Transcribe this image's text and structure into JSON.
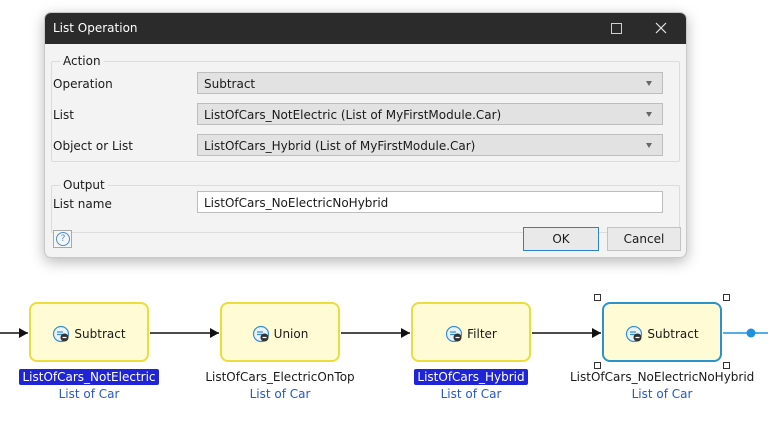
{
  "dialog": {
    "title": "List Operation",
    "action_group": {
      "legend": "Action",
      "operation_label": "Operation",
      "operation_value": "Subtract",
      "list_label": "List",
      "list_value": "ListOfCars_NotElectric (List of MyFirstModule.Car)",
      "object_label": "Object or List",
      "object_value": "ListOfCars_Hybrid (List of MyFirstModule.Car)"
    },
    "output_group": {
      "legend": "Output",
      "list_name_label": "List name",
      "list_name_value": "ListOfCars_NoElectricNoHybrid"
    },
    "help_icon_glyph": "?",
    "ok_label": "OK",
    "cancel_label": "Cancel"
  },
  "flow": {
    "activities": [
      {
        "name": "Subtract",
        "var": "ListOfCars_NotElectric",
        "type": "List of Car",
        "highlighted": true,
        "selected": false
      },
      {
        "name": "Union",
        "var": "ListOfCars_ElectricOnTop",
        "type": "List of Car",
        "highlighted": false,
        "selected": false
      },
      {
        "name": "Filter",
        "var": "ListOfCars_Hybrid",
        "type": "List of Car",
        "highlighted": true,
        "selected": false
      },
      {
        "name": "Subtract",
        "var": "ListOfCars_NoElectricNoHybrid",
        "type": "List of Car",
        "highlighted": false,
        "selected": true
      }
    ]
  },
  "colors": {
    "titlebar": "#2b2b2b",
    "activity_fill": "#fffbd4",
    "activity_border": "#eadd3c",
    "selected_border": "#2a93c9",
    "highlight": "#1f24d8",
    "type_text": "#2456d6",
    "flow_line": "#111111",
    "end_dot": "#1e90e0"
  },
  "icons": {
    "maximize": "maximize-icon",
    "close": "close-icon",
    "help": "help-icon",
    "activity": "list-operation-icon",
    "dropdown": "chevron-down-icon"
  }
}
